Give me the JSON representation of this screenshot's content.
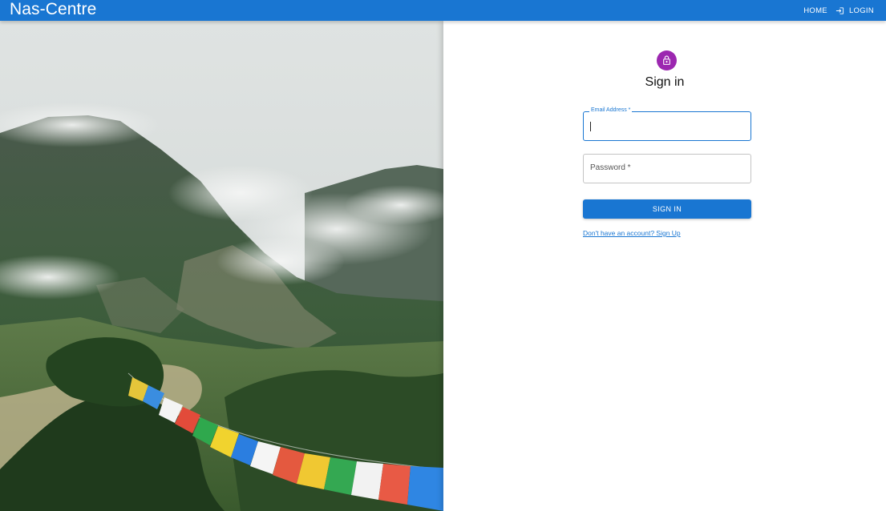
{
  "app": {
    "title": "Nas-Centre"
  },
  "nav": {
    "home_label": "HOME",
    "login_label": "LOGIN",
    "login_icon": "login-icon"
  },
  "form": {
    "avatar_icon": "lock-icon",
    "title": "Sign in",
    "email": {
      "label": "Email Address *",
      "value": ""
    },
    "password": {
      "label": "Password *",
      "value": ""
    },
    "submit_label": "SIGN IN",
    "signup_link": "Don't have an account? Sign Up"
  },
  "colors": {
    "primary": "#1976d2",
    "avatar": "#9c27b0"
  }
}
